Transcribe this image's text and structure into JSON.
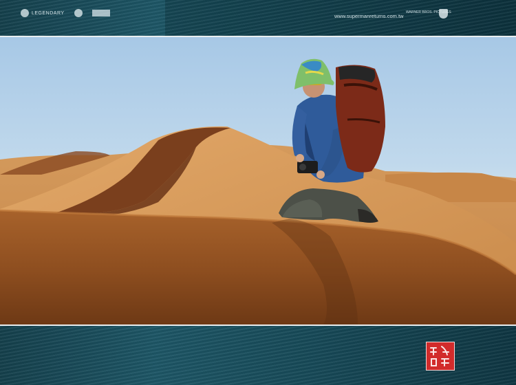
{
  "top_band": {
    "logos": [
      {
        "name": "legendary-logo",
        "text": "LEGENDARY"
      },
      {
        "name": "studio-logo-2",
        "text": ""
      },
      {
        "name": "studio-logo-3",
        "text": ""
      }
    ],
    "url": "www.supermanreturns.com.tw",
    "studio": "WARNER BROS. PICTURES"
  },
  "photo": {
    "description_icon": "desert-hiker-photo"
  },
  "seal": {
    "icon": "red-chop-seal-icon",
    "color": "#d22b2b"
  },
  "colors": {
    "band": "#1d5666",
    "sand": "#c98a4a",
    "sky": "#a7c8e6"
  }
}
